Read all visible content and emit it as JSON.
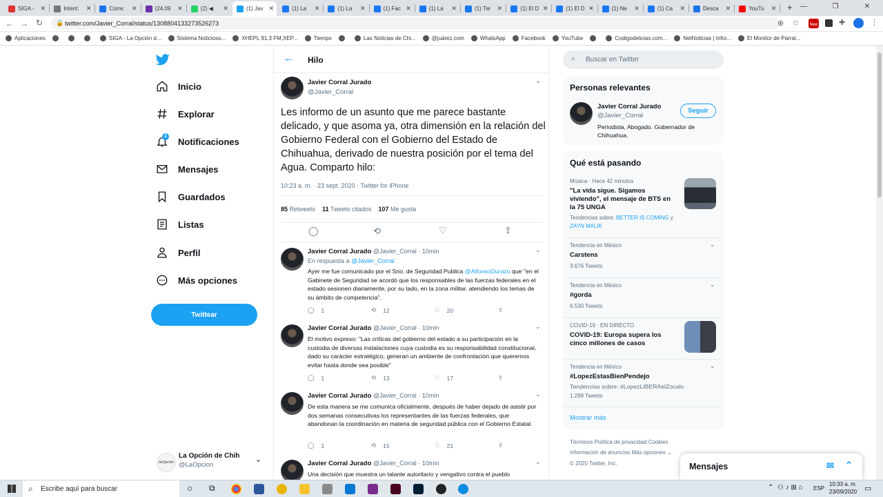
{
  "browser": {
    "tabs": [
      {
        "label": "SIGA -",
        "color": "#d33"
      },
      {
        "label": "Intent:",
        "color": "#777"
      },
      {
        "label": "Corre:",
        "color": "#1a73e8"
      },
      {
        "label": "(24.09",
        "color": "#6b2fa8"
      },
      {
        "label": "(2) ◀",
        "color": "#25d366"
      },
      {
        "label": "(1) Jav",
        "color": "#1da1f2"
      },
      {
        "label": "(1) La",
        "color": "#1877f2"
      },
      {
        "label": "(1) La",
        "color": "#1877f2"
      },
      {
        "label": "(1) Fac",
        "color": "#1877f2"
      },
      {
        "label": "(1) La",
        "color": "#1877f2"
      },
      {
        "label": "(1) Tie",
        "color": "#1877f2"
      },
      {
        "label": "(1) El D",
        "color": "#1877f2"
      },
      {
        "label": "(1) El D",
        "color": "#1877f2"
      },
      {
        "label": "(1) Ne",
        "color": "#1877f2"
      },
      {
        "label": "(1) Ca",
        "color": "#1877f2"
      },
      {
        "label": "Desca",
        "color": "#1a73e8"
      },
      {
        "label": "YouTu",
        "color": "#ff0000"
      }
    ],
    "new_tab": "+",
    "url": "twitter.com/Javier_Corral/status/1308804133273526273",
    "bookmarks": [
      "Aplicaciones",
      "",
      "",
      "",
      "SIGA - La Opción d...",
      "Sistema Noticioso...",
      "XHEPL 91.3 FM,XEP...",
      "Tiempo",
      "",
      "Las Noticias de Chi...",
      "@juárez.com",
      "WhatsApp",
      "Facebook",
      "YouTube",
      "",
      "Codigodelicias.com...",
      "NetNoticias | Infor...",
      "El Monitor de Parral..."
    ],
    "profile_badge": "New"
  },
  "nav": {
    "items": [
      "Inicio",
      "Explorar",
      "Notificaciones",
      "Mensajes",
      "Guardados",
      "Listas",
      "Perfil",
      "Más opciones"
    ],
    "notif_count": "1",
    "tweet_button": "Twittear",
    "account_name": "La Opción de Chih",
    "account_handle": "@LaOpcion",
    "account_logo": "laOpción"
  },
  "thread": {
    "header": "Hilo",
    "author": "Javier Corral Jurado",
    "handle": "@Javier_Corral",
    "text": "Les informo de un asunto que me parece bastante delicado, y que asoma ya, otra dimensión en la relación del Gobierno Federal con el Gobierno del Estado de Chihuahua, derivado de nuestra posición por el tema del Agua. Comparto hilo:",
    "meta": "10:23 a. m. · 23 sept. 2020 · Twitter for iPhone",
    "retweets": "85",
    "retweets_label": "Retweets",
    "quotes": "11",
    "quotes_label": "Tweets citados",
    "likes": "107",
    "likes_label": "Me gusta",
    "replies": [
      {
        "name": "Javier Corral Jurado",
        "handle": "@Javier_Corral",
        "time": "· 10min",
        "reply_to_prefix": "En respuesta a",
        "reply_to": "@Javier_Corral",
        "text_before": "Ayer me fue comunicado por el Srio. de Seguridad Publica ",
        "mention": "@AlfonsoDurazo",
        "text_after": " que \"en el Gabinete de Seguridad se acordó que los responsables de las fuerzas federales en el estado sesionen diariamente, por su lado, en la zona militar, atendiendo los temas de su ámbito de competencia\".",
        "comments": "1",
        "retweets": "12",
        "likes": "20"
      },
      {
        "name": "Javier Corral Jurado",
        "handle": "@Javier_Corral",
        "time": "· 10min",
        "text": "El motivo expreso: \"Las críticas del gobierno del estado a su participación en la custodia de diversas instalaciones cuya custodia es su responsabilidad constitucional, dado su carácter estratégico, generan un ambiente de confrontación que queremos evitar hasta donde sea posible\"",
        "comments": "1",
        "retweets": "13",
        "likes": "17"
      },
      {
        "name": "Javier Corral Jurado",
        "handle": "@Javier_Corral",
        "time": "· 10min",
        "text": "De esta manera se me comunica oficialmente, después de haber dejado de asistir por dos semanas consecutivas los representantes de las fuerzas federales, que abandonan la coordinación en materia de seguridad pública con el Gobierno Estatal.",
        "comments": "1",
        "retweets": "15",
        "likes": "21"
      },
      {
        "name": "Javier Corral Jurado",
        "handle": "@Javier_Corral",
        "time": "· 10min",
        "text": "Una decisión que muestra un talante autoritario y vengativo contra el pueblo"
      }
    ]
  },
  "sidebar": {
    "search_placeholder": "Buscar en Twitter",
    "relevant_title": "Personas relevantes",
    "person_name": "Javier Corral Jurado",
    "person_handle": "@Javier_Corral",
    "person_bio": "Periodista, Abogado. Gobernador de Chihuahua.",
    "follow_label": "Seguir",
    "trends_title": "Qué está pasando",
    "trend1_meta": "Música · Hace 42 minutos",
    "trend1_name": "\"La vida sigue. Sigamos viviendo\", el mensaje de BTS en la 75 UNGA",
    "trend1_sub_prefix": "Tendencias sobre:",
    "trend1_sub": "BETTER IS COMING",
    "trend1_and": "y",
    "trend1_sub2": "ZAYN MALIK",
    "trend2_meta": "Tendencia en México",
    "trend2_name": "Carstens",
    "trend2_count": "3.676 Tweets",
    "trend3_meta": "Tendencia en México",
    "trend3_name": "#gorda",
    "trend3_count": "6.530 Tweets",
    "trend4_meta": "COVID-19 · EN DIRECTO",
    "trend4_name": "COVID-19: Europa supera los cinco millones de casos",
    "trend5_meta": "Tendencia en México",
    "trend5_name": "#LopezEstasBienPendejo",
    "trend5_sub": "Tendencias sobre: #LopezLIBERAelZocalo",
    "trend5_count": "1.288 Tweets",
    "show_more": "Mostrar más",
    "footer1": "Términos    Política de privacidad    Cookies",
    "footer2": "Información de anuncios    Más opciones ⌄",
    "footer3": "© 2020 Twitter, Inc."
  },
  "messages_dock": "Mensajes",
  "taskbar": {
    "search": "Escribe aquí para buscar",
    "lang": "ESP",
    "time": "10:33 a. m.",
    "date": "23/09/2020"
  }
}
